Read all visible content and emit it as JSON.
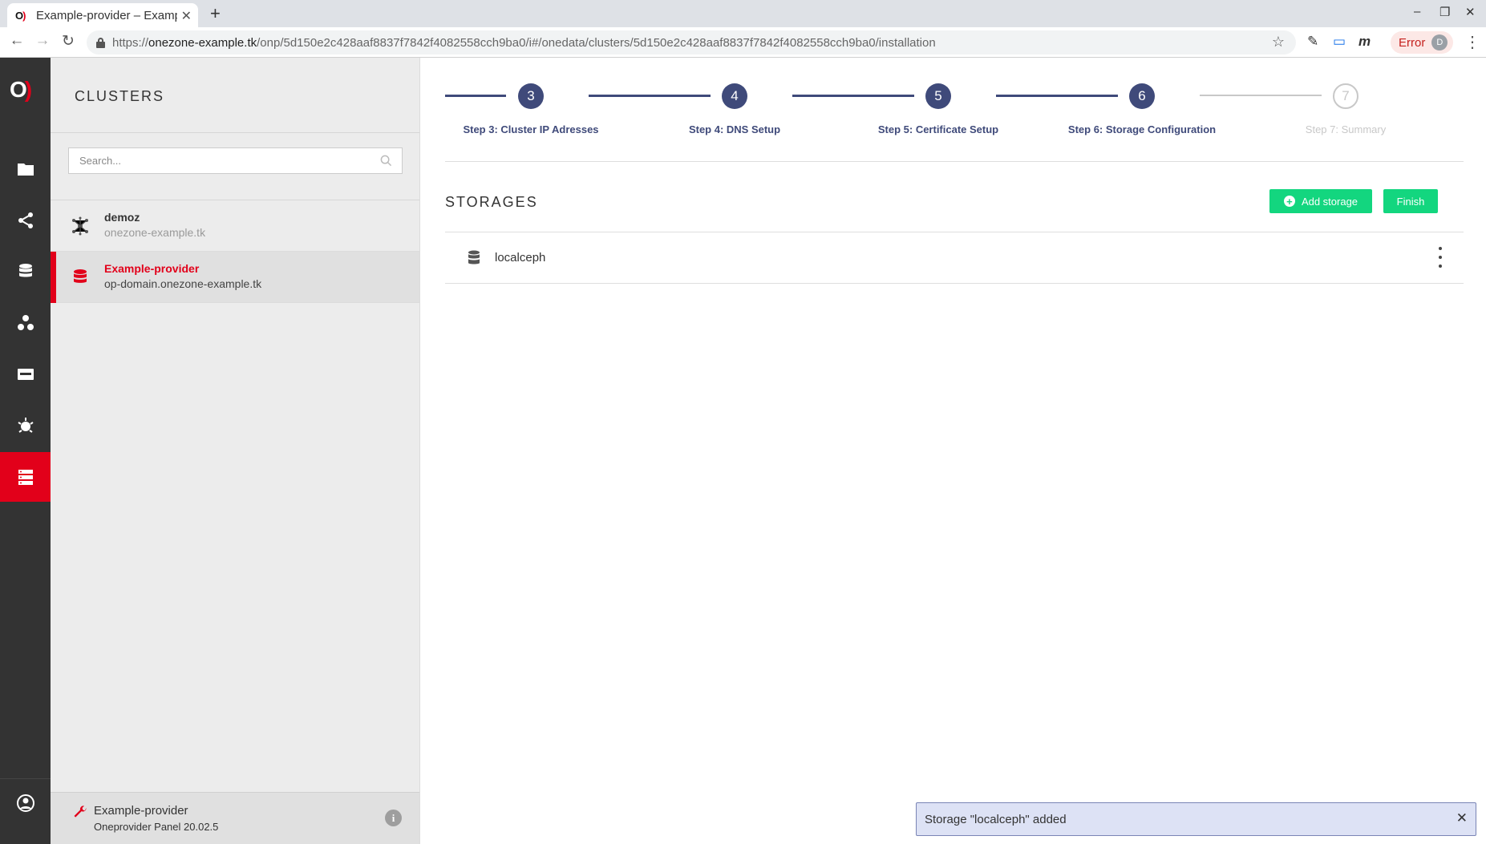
{
  "browser": {
    "tab_title": "Example-provider – Example",
    "url_scheme": "https://",
    "url_host": "onezone-example.tk",
    "url_path": "/onp/5d150e2c428aaf8837f7842f4082558cch9ba0/i#/onedata/clusters/5d150e2c428aaf8837f7842f4082558cch9ba0/installation",
    "profile_status": "Error",
    "profile_initial": "D"
  },
  "sidebar": {
    "title": "CLUSTERS",
    "search_placeholder": "Search...",
    "clusters": [
      {
        "name": "demoz",
        "domain": "onezone-example.tk"
      },
      {
        "name": "Example-provider",
        "domain": "op-domain.onezone-example.tk"
      }
    ],
    "footer": {
      "title": "Example-provider",
      "subtitle": "Oneprovider Panel 20.02.5"
    }
  },
  "stepper": {
    "steps": [
      {
        "number": "3",
        "label": "Step 3: Cluster IP Adresses",
        "state": "done"
      },
      {
        "number": "4",
        "label": "Step 4: DNS Setup",
        "state": "done"
      },
      {
        "number": "5",
        "label": "Step 5: Certificate Setup",
        "state": "done"
      },
      {
        "number": "6",
        "label": "Step 6: Storage Configuration",
        "state": "current"
      },
      {
        "number": "7",
        "label": "Step 7: Summary",
        "state": "future"
      }
    ]
  },
  "storages": {
    "title": "STORAGES",
    "add_label": "Add storage",
    "finish_label": "Finish",
    "items": [
      {
        "name": "localceph"
      }
    ]
  },
  "notification": {
    "message": "Storage \"localceph\" added"
  },
  "colors": {
    "brand_red": "#e2001a",
    "step_active": "#3f4a7a",
    "button_green": "#13d67f",
    "rail_bg": "#333333"
  }
}
